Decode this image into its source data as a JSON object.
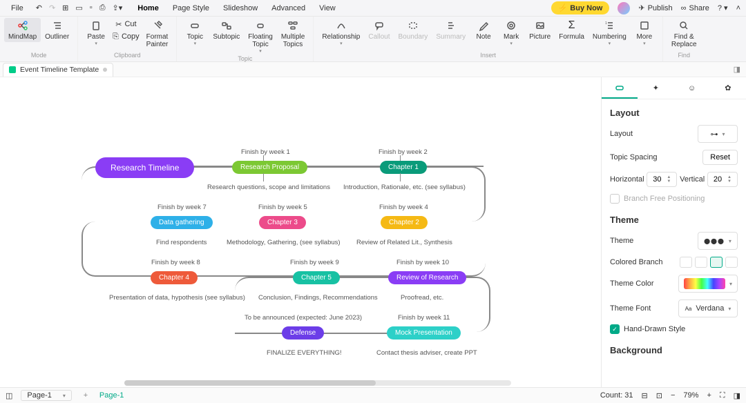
{
  "menus": {
    "file": "File",
    "home": "Home",
    "page": "Page Style",
    "slide": "Slideshow",
    "adv": "Advanced",
    "view": "View"
  },
  "topright": {
    "buy": "Buy Now",
    "publish": "Publish",
    "share": "Share"
  },
  "ribbon": {
    "mode": {
      "mindmap": "MindMap",
      "outliner": "Outliner",
      "label": "Mode"
    },
    "clip": {
      "paste": "Paste",
      "cut": "Cut",
      "copy": "Copy",
      "fmt1": "Format",
      "fmt2": "Painter",
      "label": "Clipboard"
    },
    "topic": {
      "topic": "Topic",
      "subtopic": "Subtopic",
      "floating": "Floating\nTopic",
      "multiple": "Multiple\nTopics",
      "label": "Topic"
    },
    "insert": {
      "rel": "Relationship",
      "callout": "Callout",
      "boundary": "Boundary",
      "summary": "Summary",
      "note": "Note",
      "mark": "Mark",
      "picture": "Picture",
      "formula": "Formula",
      "numbering": "Numbering",
      "more": "More",
      "label": "Insert"
    },
    "find": {
      "l1": "Find &",
      "l2": "Replace",
      "label": "Find"
    }
  },
  "filetab": {
    "name": "Event Timeline Template"
  },
  "side": {
    "layout": {
      "title": "Layout",
      "layoutlbl": "Layout",
      "spacing": "Topic Spacing",
      "reset": "Reset",
      "hlabel": "Horizontal",
      "hval": "30",
      "vlabel": "Vertical",
      "vval": "20",
      "freepos": "Branch Free Positioning"
    },
    "theme": {
      "title": "Theme",
      "themelbl": "Theme",
      "branch": "Colored Branch",
      "color": "Theme Color",
      "font": "Theme Font",
      "fontval": "Verdana",
      "hand": "Hand-Drawn Style"
    },
    "bg": {
      "title": "Background"
    }
  },
  "mind": {
    "root": "Research Timeline",
    "c1": {
      "due": "Finish by week 1",
      "name": "Research Proposal",
      "note": "Research questions, scope and limitations"
    },
    "c2": {
      "due": "Finish by week 2",
      "name": "Chapter 1",
      "note": "Introduction, Rationale, etc. (see syllabus)"
    },
    "c3": {
      "due": "Finish by week 7",
      "name": "Data gathering",
      "note": "Find respondents"
    },
    "c4": {
      "due": "Finish by week 5",
      "name": "Chapter 3",
      "note": "Methodology, Gathering, (see syllabus)"
    },
    "c5": {
      "due": "Finish by week 4",
      "name": "Chapter 2",
      "note": "Review of Related Lit., Synthesis"
    },
    "c6": {
      "due": "Finish by week 8",
      "name": "Chapter 4",
      "note": "Presentation of data, hypothesis (see syllabus)"
    },
    "c7": {
      "due": "Finish by week 9",
      "name": "Chapter 5",
      "note": "Conclusion, Findings, Recommendations"
    },
    "c8": {
      "due": "Finish by week 10",
      "name": "Review of Research",
      "note": "Proofread, etc."
    },
    "c9": {
      "due": "To be announced (expected: June 2023)",
      "name": "Defense",
      "note": "FINALIZE EVERYTHING!"
    },
    "c10": {
      "due": "Finish by week 11",
      "name": "Mock Presentation",
      "note": "Contact thesis adviser, create PPT"
    }
  },
  "status": {
    "page": "Page-1",
    "pgtab": "Page-1",
    "count": "Count: 31",
    "zoom": "79%"
  }
}
